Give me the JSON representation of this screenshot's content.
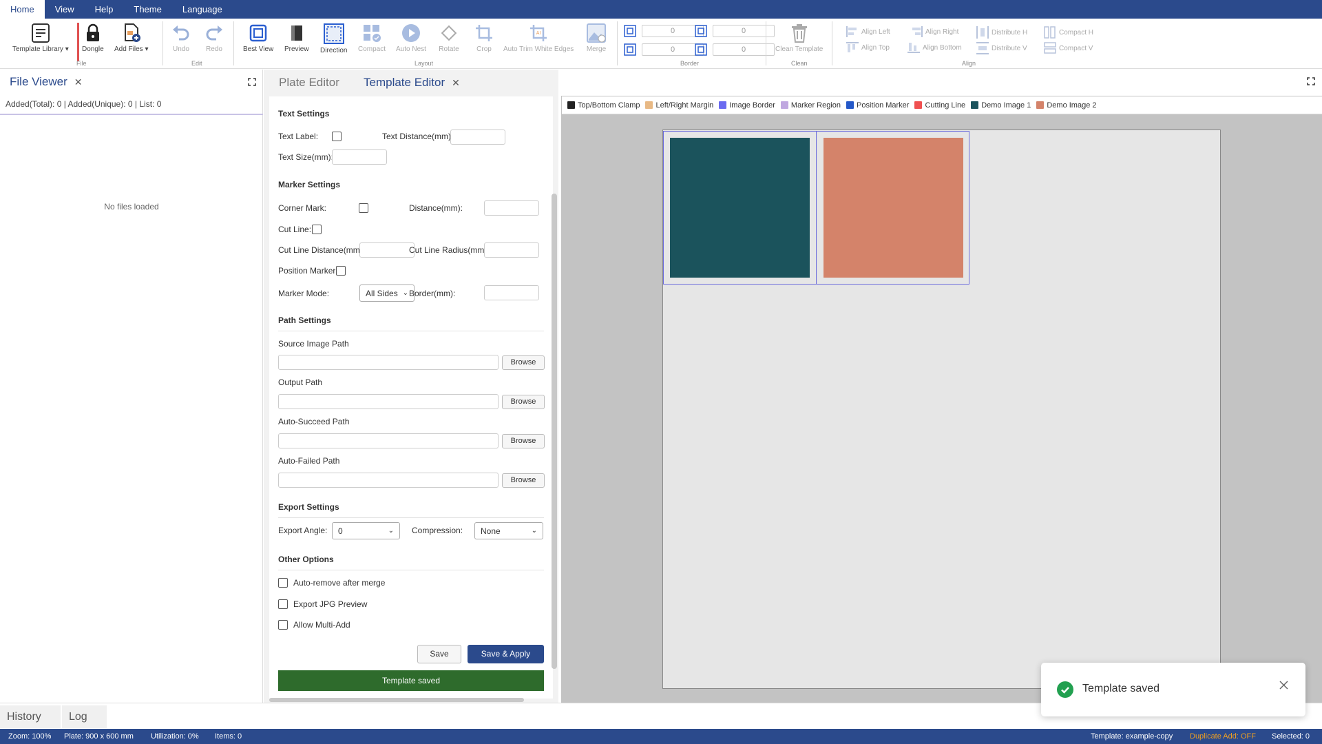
{
  "menubar": {
    "items": [
      "Home",
      "View",
      "Help",
      "Theme",
      "Language"
    ]
  },
  "ribbon": {
    "file": {
      "template_library": "Template Library",
      "dongle": "Dongle",
      "add_files": "Add Files",
      "group": "File"
    },
    "edit": {
      "undo": "Undo",
      "redo": "Redo",
      "group": "Edit"
    },
    "layout": {
      "best_view": "Best View",
      "preview": "Preview",
      "direction": "Direction",
      "compact": "Compact",
      "auto_nest": "Auto Nest",
      "rotate": "Rotate",
      "crop": "Crop",
      "auto_trim": "Auto Trim White Edges",
      "merge": "Merge",
      "group": "Layout"
    },
    "border": {
      "top": "0",
      "right": "0",
      "bottom": "0",
      "left": "0",
      "group": "Border"
    },
    "clean": {
      "clean_template": "Clean Template",
      "group": "Clean"
    },
    "align": {
      "align_left": "Align Left",
      "align_right": "Align Right",
      "distribute_h": "Distribute H",
      "compact_h": "Compact H",
      "align_top": "Align Top",
      "align_bottom": "Align Bottom",
      "distribute_v": "Distribute V",
      "compact_v": "Compact V",
      "group": "Align"
    }
  },
  "file_viewer": {
    "title": "File Viewer",
    "counts": "Added(Total): 0 | Added(Unique): 0 | List: 0",
    "empty": "No files loaded"
  },
  "center": {
    "tabs": {
      "plate_editor": "Plate Editor",
      "template_editor": "Template Editor"
    },
    "text_settings": {
      "title": "Text Settings",
      "text_label": "Text Label:",
      "text_distance": "Text Distance(mm):",
      "text_size": "Text Size(mm):"
    },
    "marker_settings": {
      "title": "Marker Settings",
      "corner_mark": "Corner Mark:",
      "distance": "Distance(mm):",
      "cut_line": "Cut Line:",
      "cut_line_distance": "Cut Line Distance(mm):",
      "cut_line_radius": "Cut Line Radius(mm):",
      "position_marker": "Position Marker:",
      "marker_mode": "Marker Mode:",
      "marker_mode_value": "All Sides",
      "border": "Border(mm):"
    },
    "path_settings": {
      "title": "Path Settings",
      "source": "Source Image Path",
      "output": "Output Path",
      "auto_succeed": "Auto-Succeed Path",
      "auto_failed": "Auto-Failed Path",
      "browse": "Browse"
    },
    "export_settings": {
      "title": "Export Settings",
      "export_angle": "Export Angle:",
      "export_angle_value": "0",
      "compression": "Compression:",
      "compression_value": "None"
    },
    "other_options": {
      "title": "Other Options",
      "auto_remove": "Auto-remove after merge",
      "export_jpg": "Export JPG Preview",
      "allow_multi": "Allow Multi-Add"
    },
    "buttons": {
      "save": "Save",
      "save_apply": "Save & Apply"
    },
    "status": "Template saved"
  },
  "legend": {
    "items": [
      {
        "label": "Top/Bottom Clamp",
        "color": "#222222"
      },
      {
        "label": "Left/Right Margin",
        "color": "#e8b985"
      },
      {
        "label": "Image Border",
        "color": "#6a6af0"
      },
      {
        "label": "Marker Region",
        "color": "#c0a8e0"
      },
      {
        "label": "Position Marker",
        "color": "#2458c8"
      },
      {
        "label": "Cutting Line",
        "color": "#f05050"
      },
      {
        "label": "Demo Image 1",
        "color": "#1b535c"
      },
      {
        "label": "Demo Image 2",
        "color": "#d4836a"
      }
    ]
  },
  "bottom_tabs": {
    "history": "History",
    "log": "Log"
  },
  "statusbar": {
    "zoom": "Zoom: 100%",
    "plate": "Plate: 900 x 600 mm",
    "utilization": "Utilization: 0%",
    "items": "Items: 0",
    "template": "Template: example-copy",
    "duplicate": "Duplicate Add: OFF",
    "selected": "Selected: 0"
  },
  "toast": {
    "message": "Template saved"
  },
  "colors": {
    "primary": "#2b4a8c",
    "success": "#2e6b2c",
    "warning": "#f0a020"
  }
}
